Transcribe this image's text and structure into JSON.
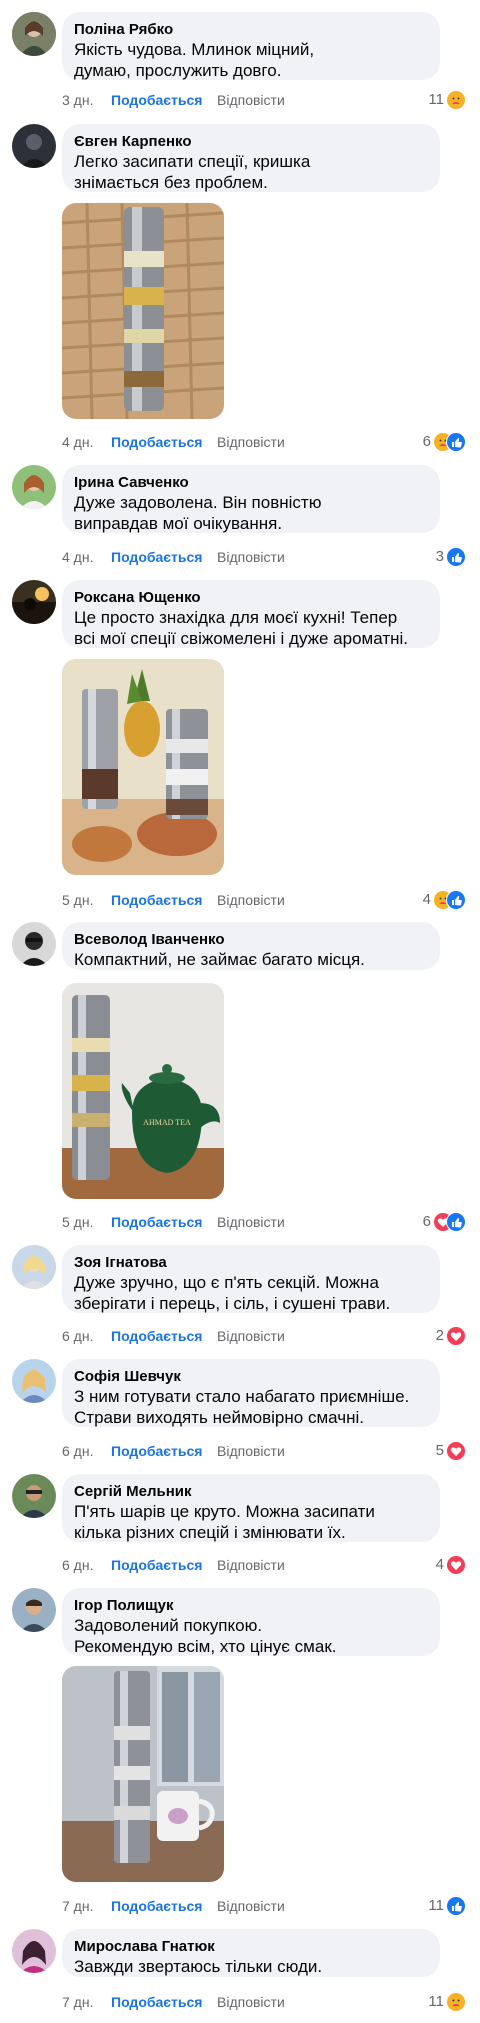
{
  "ui": {
    "like_label": "Подобається",
    "reply_label": "Відповісти"
  },
  "comments": [
    {
      "name": "Поліна Рябко",
      "text": "Якість чудова. Млинок міцний,\nдумаю, прослужить довго.",
      "time": "3 дн.",
      "count": "11",
      "reactions": [
        "care"
      ]
    },
    {
      "name": "Євген Карпенко",
      "text": "Легко засипати спеції, кришка\nзнімається без проблем.",
      "time": "4 дн.",
      "count": "6",
      "reactions": [
        "care",
        "like"
      ]
    },
    {
      "name": "Ірина Савченко",
      "text": "Дуже задоволена. Він повністю\nвиправдав мої очікування.",
      "time": "4 дн.",
      "count": "3",
      "reactions": [
        "like"
      ]
    },
    {
      "name": "Роксана Ющенко",
      "text": "Це просто знахідка для моєї кухні! Тепер\nвсі мої спеції свіжомелені і дуже ароматні.",
      "time": "5 дн.",
      "count": "4",
      "reactions": [
        "care",
        "like"
      ]
    },
    {
      "name": "Всеволод Іванченко",
      "text": "Компактний, не займає багато місця.",
      "time": "5 дн.",
      "count": "6",
      "reactions": [
        "love",
        "like"
      ]
    },
    {
      "name": "Зоя Ігнатова",
      "text": "Дуже зручно, що є п'ять секцій. Можна\nзберігати і перець, і сіль, і сушені трави.",
      "time": "6 дн.",
      "count": "2",
      "reactions": [
        "love"
      ]
    },
    {
      "name": "Софія Шевчук",
      "text": "З ним готувати стало набагато приємніше.\nСтрави виходять неймовірно смачні.",
      "time": "6 дн.",
      "count": "5",
      "reactions": [
        "love"
      ]
    },
    {
      "name": "Сергій Мельник",
      "text": "П'ять шарів це круто. Можна засипати\nкілька різних спецій і змінювати їх.",
      "time": "6 дн.",
      "count": "4",
      "reactions": [
        "love"
      ]
    },
    {
      "name": "Ігор Полищук",
      "text": "Задоволений покупкою.\nРекомендую всім, хто цінує смак.",
      "time": "7 дн.",
      "count": "11",
      "reactions": [
        "like"
      ]
    },
    {
      "name": "Мирослава Гнатюк",
      "text": "Завжди звертаюсь тільки сюди.",
      "time": "7 дн.",
      "count": "11",
      "reactions": [
        "care"
      ]
    }
  ],
  "photos": {
    "p1": "grinder-on-wicker",
    "p3": "grinders-with-pineapple",
    "p4": "grinder-with-teapot",
    "p8": "grinder-with-mug"
  },
  "teapot_text": "AHMAD TEA"
}
